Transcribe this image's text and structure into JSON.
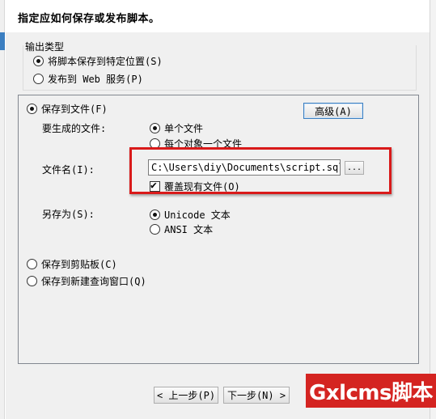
{
  "header": {
    "title": "指定应如何保存或发布脚本。"
  },
  "output_type": {
    "label": "输出类型",
    "options": [
      {
        "label": "将脚本保存到特定位置(S)",
        "selected": true
      },
      {
        "label": "发布到 Web 服务(P)",
        "selected": false
      }
    ]
  },
  "save_to_file": {
    "label": "保存到文件(F)",
    "selected": true,
    "advanced_label": "高级(A)",
    "files_to_generate_label": "要生成的文件:",
    "files_options": [
      {
        "label": "单个文件",
        "selected": true
      },
      {
        "label": "每个对象一个文件",
        "selected": false
      }
    ],
    "filename_label": "文件名(I):",
    "filename_value": "C:\\Users\\diy\\Documents\\script.sql",
    "browse_label": "...",
    "overwrite_label": "覆盖现有文件(O)",
    "overwrite_checked": true,
    "save_as_label": "另存为(S):",
    "encoding_options": [
      {
        "label": "Unicode 文本",
        "selected": true
      },
      {
        "label": "ANSI 文本",
        "selected": false
      }
    ]
  },
  "save_to_clipboard": {
    "label": "保存到剪贴板(C)",
    "selected": false
  },
  "save_to_query_window": {
    "label": "保存到新建查询窗口(Q)",
    "selected": false
  },
  "footer": {
    "prev_label": "< 上一步(P)",
    "next_label": "下一步(N) >"
  },
  "watermark": {
    "text": "Gxlcms脚本"
  },
  "colors": {
    "highlight": "#d91a1a",
    "accent": "#3c7fc1",
    "watermark_bg": "#d42421"
  }
}
